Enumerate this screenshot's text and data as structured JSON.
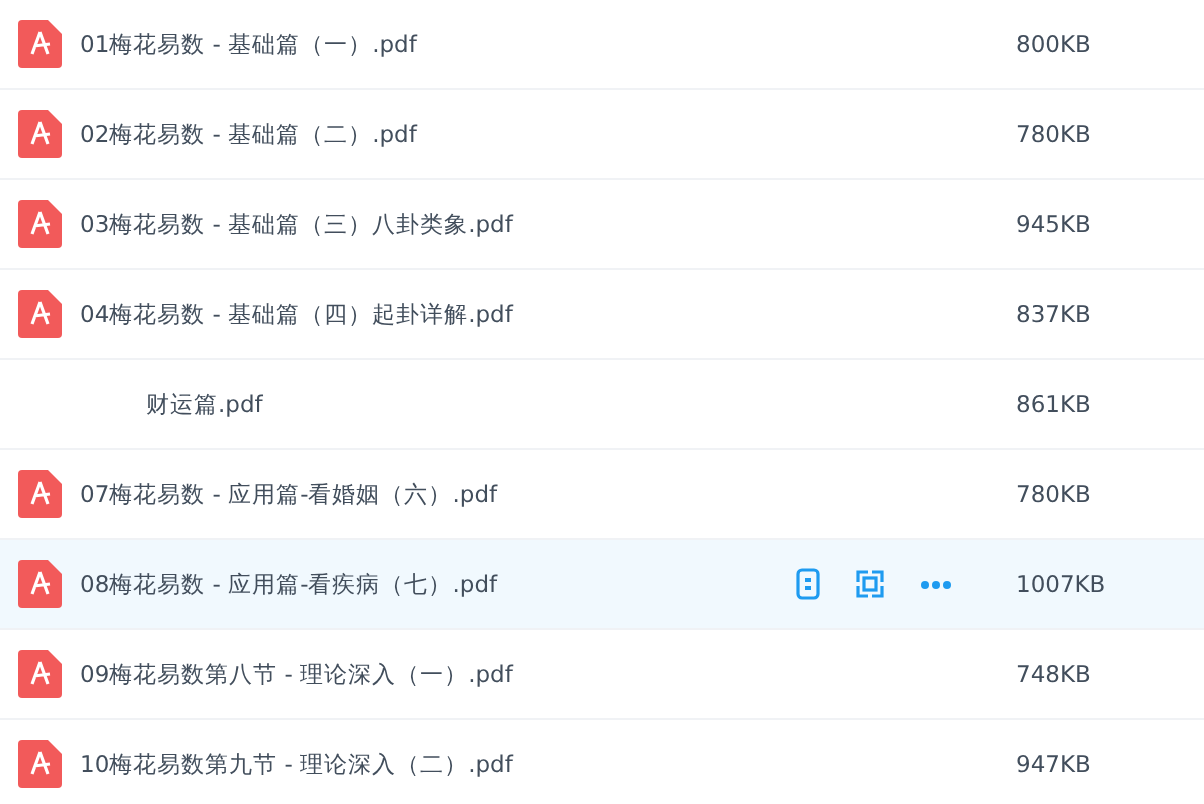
{
  "files": [
    {
      "name": "01梅花易数 - 基础篇（一）.pdf",
      "size": "800KB",
      "selected": false,
      "kind": "full"
    },
    {
      "name": "02梅花易数 - 基础篇（二）.pdf",
      "size": "780KB",
      "selected": false,
      "kind": "full"
    },
    {
      "name": "03梅花易数 - 基础篇（三）八卦类象.pdf",
      "size": "945KB",
      "selected": false,
      "kind": "full"
    },
    {
      "name": "04梅花易数 - 基础篇（四）起卦详解.pdf",
      "size": "837KB",
      "selected": false,
      "kind": "full"
    },
    {
      "name": "财运篇.pdf",
      "size": "861KB",
      "selected": false,
      "kind": "partial"
    },
    {
      "name": "07梅花易数 - 应用篇-看婚姻（六）.pdf",
      "size": "780KB",
      "selected": false,
      "kind": "full"
    },
    {
      "name": "08梅花易数 - 应用篇-看疾病（七）.pdf",
      "size": "1007KB",
      "selected": true,
      "kind": "full"
    },
    {
      "name": "09梅花易数第八节 - 理论深入（一）.pdf",
      "size": "748KB",
      "selected": false,
      "kind": "full"
    },
    {
      "name": "10梅花易数第九节 - 理论深入（二）.pdf",
      "size": "947KB",
      "selected": false,
      "kind": "full"
    }
  ]
}
